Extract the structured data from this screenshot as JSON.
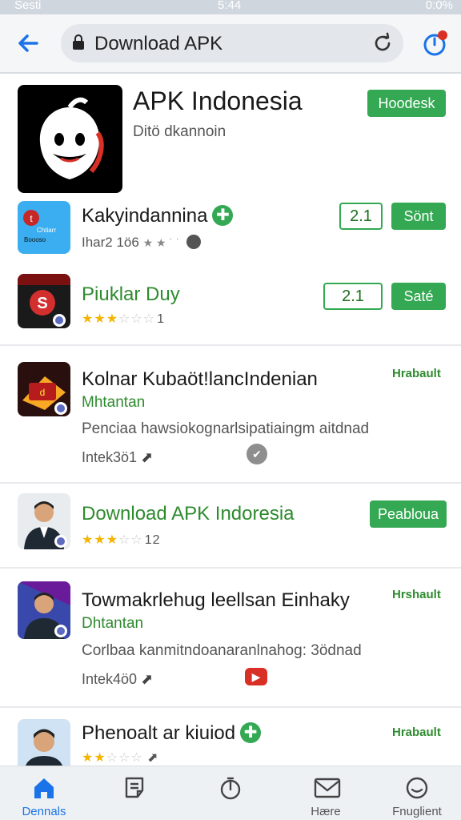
{
  "status_bar": {
    "left": "Sesti",
    "time": "5:44",
    "battery": "0:0%"
  },
  "address_bar": {
    "url": "Download APK"
  },
  "featured": {
    "title": "APK Indonesia",
    "subtitle": "Ditö dkannoin",
    "button": "Hoodesk"
  },
  "apps": [
    {
      "title": "Kakyindannina",
      "meta": "Ihar2 1ö6",
      "version": "2.1",
      "button": "Sönt",
      "icon_lines": [
        "Chtiarr",
        "Boooso"
      ]
    },
    {
      "title": "Piuklar Duy",
      "rating_num": "1",
      "version": "2.1",
      "button": "Saté"
    },
    {
      "title": "Kolnar Kubaöt!lancIndenian",
      "tag": "Hrabault",
      "subtitle": "Mhtantan",
      "desc": "Penciaa hawsiokognarlsipatiaingm  aitdnad",
      "meta": "Intek3ö1"
    },
    {
      "title": "Download APK Indoresia",
      "rating_num": "12",
      "button": "Peabloua"
    },
    {
      "title": "Towmakrlehug leellsan Einhaky",
      "tag": "Hrshault",
      "subtitle": "Dhtantan",
      "desc": "Corlbaa kanmitndoanaranlnahog: 3ödnad",
      "meta": "Intek4ö0"
    },
    {
      "title": "Phenoalt ar kiuiod",
      "tag": "Hrabault"
    }
  ],
  "bottom_nav": [
    {
      "label": "Dennals",
      "icon": "home-icon",
      "active": true
    },
    {
      "label": "",
      "icon": "document-icon",
      "active": false
    },
    {
      "label": "",
      "icon": "timer-icon",
      "active": false
    },
    {
      "label": "Hære",
      "icon": "mail-icon",
      "active": false
    },
    {
      "label": "Fnuglient",
      "icon": "smile-icon",
      "active": false
    }
  ],
  "colors": {
    "accent_blue": "#1a73e8",
    "brand_green": "#34a853",
    "star": "#f4b400"
  }
}
